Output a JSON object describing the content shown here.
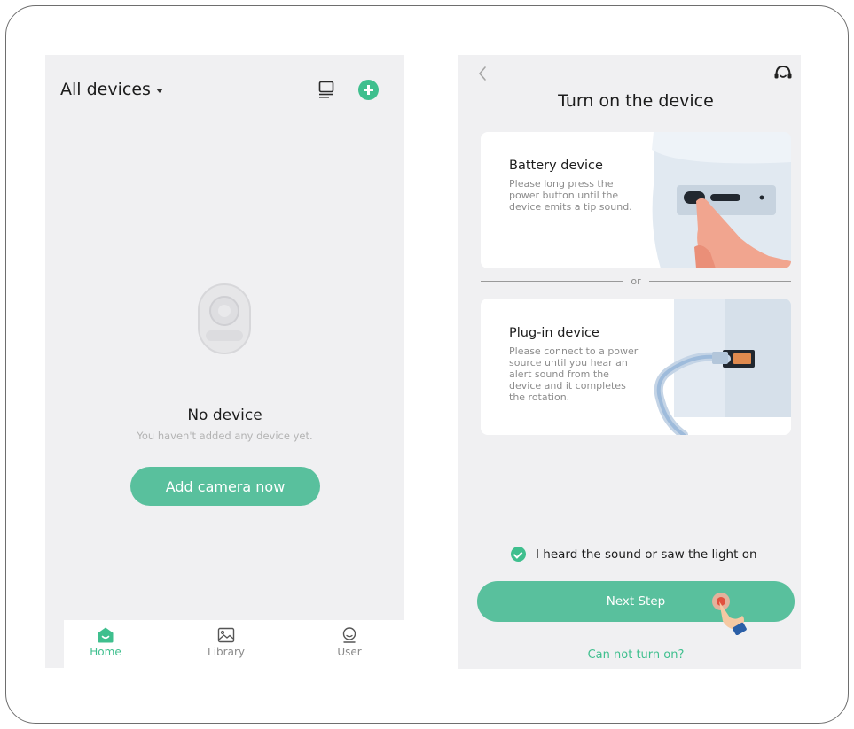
{
  "colors": {
    "accent": "#3fbf8e",
    "button": "#59c09d",
    "background": "#f0f0f2"
  },
  "left_screen": {
    "header": {
      "title": "All devices"
    },
    "icons": {
      "list": "list-view-icon",
      "add": "add-circle-icon"
    },
    "empty_state": {
      "title": "No device",
      "subtitle": "You haven't added any device yet.",
      "button_label": "Add camera now"
    },
    "tabbar": {
      "tabs": [
        {
          "label": "Home",
          "icon": "home-icon",
          "active": true
        },
        {
          "label": "Library",
          "icon": "image-icon",
          "active": false
        },
        {
          "label": "User",
          "icon": "user-icon",
          "active": false
        }
      ]
    }
  },
  "right_screen": {
    "title": "Turn on the device",
    "cards": [
      {
        "title": "Battery device",
        "description": "Please long press the power button until the device emits a tip sound."
      },
      {
        "title": "Plug-in device",
        "description": "Please connect to a power source until you hear an alert sound from the device and it completes the rotation."
      }
    ],
    "separator": "or",
    "confirm_label": "I heard the sound or saw the light on",
    "next_label": "Next Step",
    "link_label": "Can not turn on?"
  }
}
